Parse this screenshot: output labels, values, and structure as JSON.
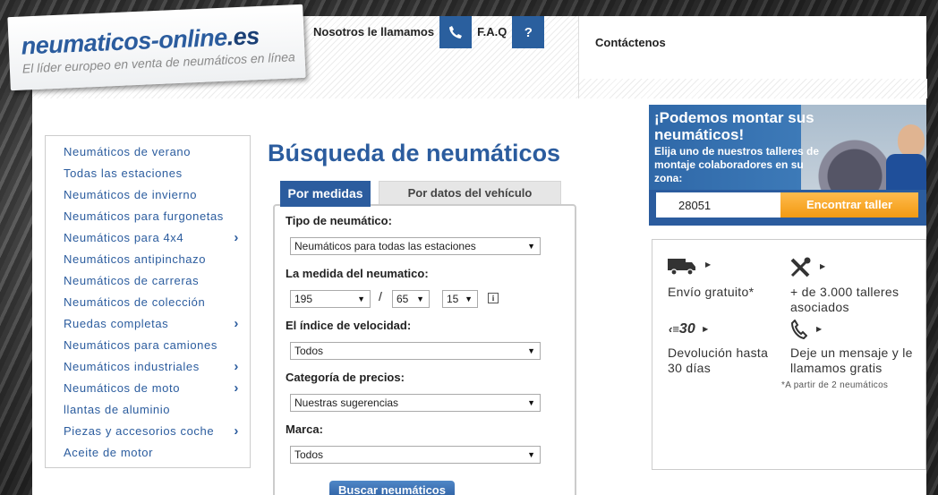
{
  "logo": {
    "title": "neumaticos-online",
    "tld": ".es",
    "subtitle": "El líder europeo en venta de neumáticos en línea"
  },
  "topnav": {
    "call_label": "Nosotros le llamamos",
    "call_icon": "phone-icon",
    "faq_label": "F.A.Q",
    "faq_icon": "?",
    "contact_label": "Contáctenos"
  },
  "sidebar": {
    "items": [
      {
        "label": "Neumáticos de verano",
        "submenu": false
      },
      {
        "label": "Todas las estaciones",
        "submenu": false
      },
      {
        "label": "Neumáticos de invierno",
        "submenu": false
      },
      {
        "label": "Neumáticos para furgonetas",
        "submenu": false
      },
      {
        "label": "Neumáticos para 4x4",
        "submenu": true
      },
      {
        "label": "Neumáticos antipinchazo",
        "submenu": false
      },
      {
        "label": "Neumáticos de carreras",
        "submenu": false
      },
      {
        "label": "Neumáticos de colección",
        "submenu": false
      },
      {
        "label": "Ruedas completas",
        "submenu": true
      },
      {
        "label": "Neumáticos para camiones",
        "submenu": false
      },
      {
        "label": "Neumáticos industriales",
        "submenu": true
      },
      {
        "label": "Neumáticos de moto",
        "submenu": true
      },
      {
        "label": "llantas de aluminio",
        "submenu": false
      },
      {
        "label": "Piezas y accesorios coche",
        "submenu": true
      },
      {
        "label": "Aceite de motor",
        "submenu": false
      }
    ],
    "chevron": "›"
  },
  "search": {
    "title": "Búsqueda de neumáticos",
    "tab_active": "Por medidas",
    "tab_inactive": "Por datos del vehículo",
    "tire_type_label": "Tipo de neumático:",
    "tire_type_value": "Neumáticos para todas las estaciones",
    "size_label": "La medida del neumatico:",
    "width_value": "195",
    "ratio_value": "65",
    "rim_value": "15",
    "slash": "/",
    "info_icon": "i",
    "speed_label": "El índice de velocidad:",
    "speed_value": "Todos",
    "price_label": "Categoría de precios:",
    "price_value": "Nuestras sugerencias",
    "brand_label": "Marca:",
    "brand_value": "Todos",
    "arrow": "▼",
    "button_label": "Buscar neumáticos"
  },
  "promo": {
    "title": "¡Podemos montar sus neumáticos!",
    "text": "Elija uno de nuestros talleres de montaje colaboradores en su zona:",
    "zip_value": "28051",
    "button_label": "Encontrar taller"
  },
  "features": {
    "shipping_text": "Envío gratuito*",
    "workshops_text": "+ de 3.000 talleres asociados",
    "returns_text": "Devolución hasta 30 días",
    "returns_badge": "30",
    "callback_text": "Deje un mensaje y le llamamos gratis",
    "note": "*A partir de 2 neumáticos",
    "arrow": "▶"
  }
}
